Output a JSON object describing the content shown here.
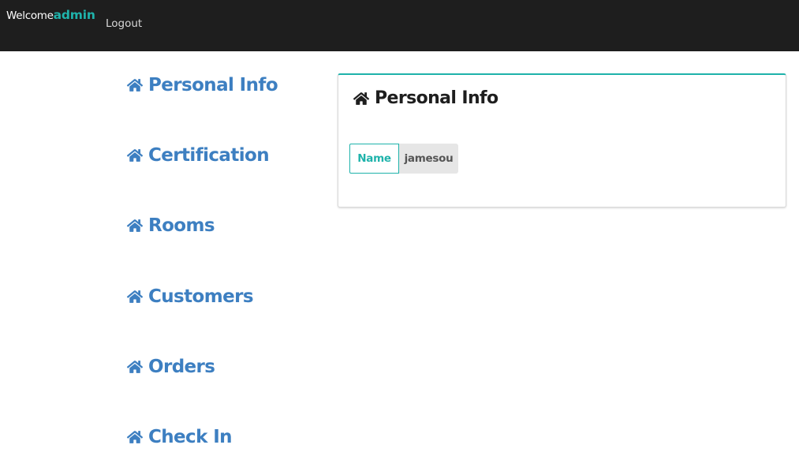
{
  "header": {
    "welcome_text": "Welcome",
    "username": "admin",
    "logout_label": "Logout"
  },
  "sidebar": {
    "icon": "home-icon",
    "items": [
      {
        "label": "Personal Info"
      },
      {
        "label": "Certification"
      },
      {
        "label": "Rooms"
      },
      {
        "label": "Customers"
      },
      {
        "label": "Orders"
      },
      {
        "label": "Check In"
      }
    ]
  },
  "panel": {
    "icon": "home-icon",
    "title": "Personal Info",
    "fields": [
      {
        "label": "Name",
        "value": "jamesou"
      }
    ]
  },
  "colors": {
    "topbar_bg": "#1e1e1e",
    "accent_teal": "#1fb3ab",
    "nav_blue": "#3d7fc1"
  }
}
